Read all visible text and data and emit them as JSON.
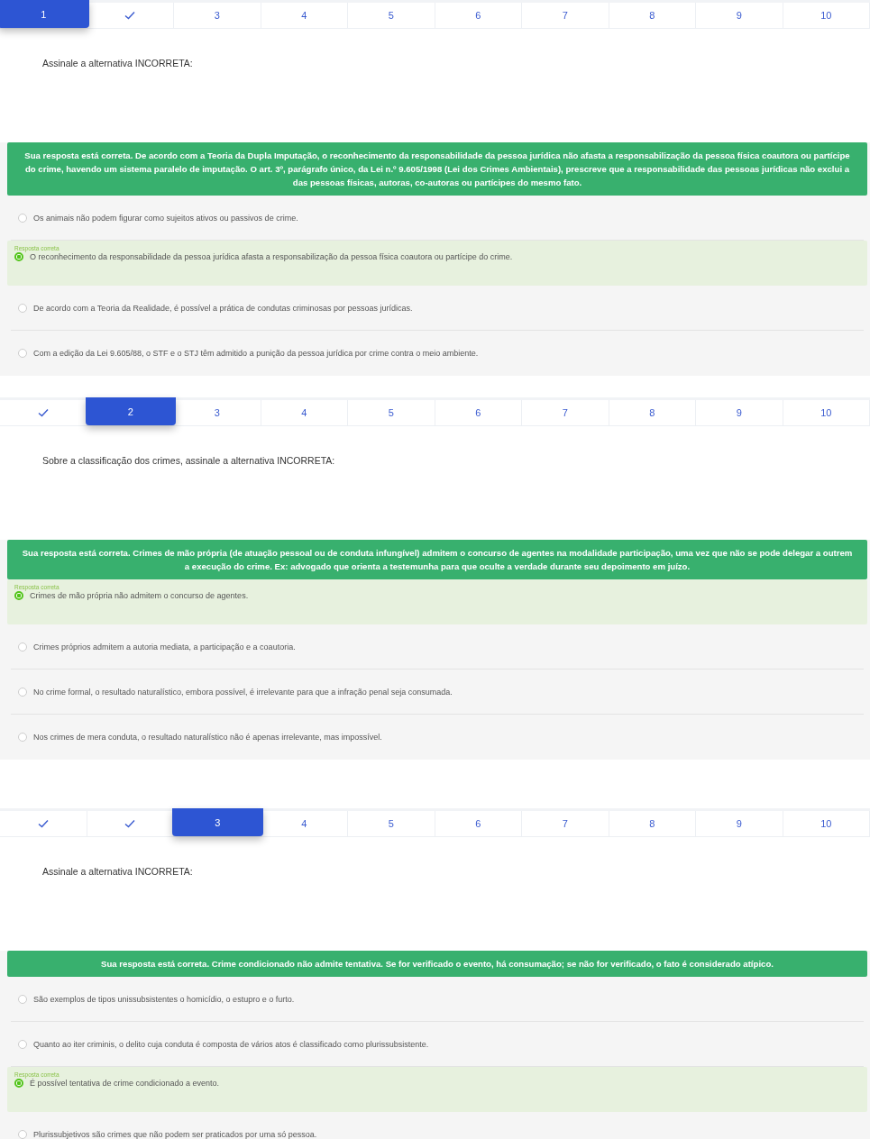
{
  "questions": [
    {
      "tabs": [
        {
          "label": "1",
          "selected": true,
          "done": false
        },
        {
          "selected": false,
          "done": true
        },
        {
          "label": "3",
          "selected": false,
          "done": false
        },
        {
          "label": "4",
          "selected": false,
          "done": false
        },
        {
          "label": "5",
          "selected": false,
          "done": false
        },
        {
          "label": "6",
          "selected": false,
          "done": false
        },
        {
          "label": "7",
          "selected": false,
          "done": false
        },
        {
          "label": "8",
          "selected": false,
          "done": false
        },
        {
          "label": "9",
          "selected": false,
          "done": false
        },
        {
          "label": "10",
          "selected": false,
          "done": false
        }
      ],
      "prompt": "Assinale a alternativa INCORRETA:",
      "feedback": "Sua resposta está correta. De acordo com a Teoria da Dupla Imputação, o reconhecimento da responsabilidade da pessoa jurídica não afasta a responsabilização da pessoa física coautora ou partícipe do crime, havendo um sistema paralelo de imputação. O art. 3º, parágrafo único, da Lei n.º 9.605/1998 (Lei dos Crimes Ambientais), prescreve que a responsabilidade das pessoas jurídicas não exclui a das pessoas físicas, autoras, co-autoras ou partícipes do mesmo fato.",
      "options": [
        {
          "text": "Os animais não podem figurar como sujeitos ativos ou passivos de crime.",
          "selected": false
        },
        {
          "text": "O reconhecimento da responsabilidade da pessoa jurídica afasta a responsabilização da pessoa física coautora ou partícipe do crime.",
          "selected": true,
          "tag": "Resposta correta"
        },
        {
          "text": "De acordo com a Teoria da Realidade, é possível a prática de condutas criminosas por pessoas jurídicas.",
          "selected": false
        },
        {
          "text": "Com a edição da Lei 9.605/88, o STF e o STJ têm admitido a punição da pessoa jurídica por crime contra o meio ambiente.",
          "selected": false
        }
      ]
    },
    {
      "tabs": [
        {
          "selected": false,
          "done": true
        },
        {
          "label": "2",
          "selected": true,
          "done": false
        },
        {
          "label": "3",
          "selected": false,
          "done": false
        },
        {
          "label": "4",
          "selected": false,
          "done": false
        },
        {
          "label": "5",
          "selected": false,
          "done": false
        },
        {
          "label": "6",
          "selected": false,
          "done": false
        },
        {
          "label": "7",
          "selected": false,
          "done": false
        },
        {
          "label": "8",
          "selected": false,
          "done": false
        },
        {
          "label": "9",
          "selected": false,
          "done": false
        },
        {
          "label": "10",
          "selected": false,
          "done": false
        }
      ],
      "prompt": "Sobre a classificação dos crimes, assinale a alternativa INCORRETA:",
      "feedback": "Sua resposta está correta. Crimes de mão própria (de atuação pessoal ou de conduta infungível) admitem o concurso de agentes na modalidade participação, uma vez que não se pode delegar a outrem a execução do crime. Ex: advogado que orienta a testemunha para que oculte a verdade durante seu depoimento em juízo.",
      "options": [
        {
          "text": "Crimes de mão própria não admitem o concurso de agentes.",
          "selected": true,
          "tag": "Resposta correta"
        },
        {
          "text": "Crimes próprios admitem a autoria mediata, a participação e a coautoria.",
          "selected": false
        },
        {
          "text": "No crime formal, o resultado naturalístico, embora possível, é irrelevante para que a infração penal seja consumada.",
          "selected": false
        },
        {
          "text": "Nos crimes de mera conduta, o resultado naturalístico não é apenas irrelevante, mas impossível.",
          "selected": false
        }
      ]
    },
    {
      "tabs": [
        {
          "selected": false,
          "done": true
        },
        {
          "selected": false,
          "done": true
        },
        {
          "label": "3",
          "selected": true,
          "done": false
        },
        {
          "label": "4",
          "selected": false,
          "done": false
        },
        {
          "label": "5",
          "selected": false,
          "done": false
        },
        {
          "label": "6",
          "selected": false,
          "done": false
        },
        {
          "label": "7",
          "selected": false,
          "done": false
        },
        {
          "label": "8",
          "selected": false,
          "done": false
        },
        {
          "label": "9",
          "selected": false,
          "done": false
        },
        {
          "label": "10",
          "selected": false,
          "done": false
        }
      ],
      "prompt": "Assinale a alternativa INCORRETA:",
      "feedback": "Sua resposta está correta. Crime condicionado não admite tentativa. Se for verificado o evento, há consumação; se não for verificado, o fato é considerado atípico.",
      "options": [
        {
          "text": "São exemplos de tipos unissubsistentes o homicídio, o estupro e o furto.",
          "selected": false
        },
        {
          "text": "Quanto ao iter criminis, o delito cuja conduta é composta de vários atos é classificado como plurissubsistente.",
          "selected": false
        },
        {
          "text": "É possível tentativa de crime condicionado a evento.",
          "selected": true,
          "tag": "Resposta correta"
        },
        {
          "text": "Plurissubjetivos são crimes que não podem ser praticados por uma só pessoa.",
          "selected": false
        }
      ]
    }
  ]
}
